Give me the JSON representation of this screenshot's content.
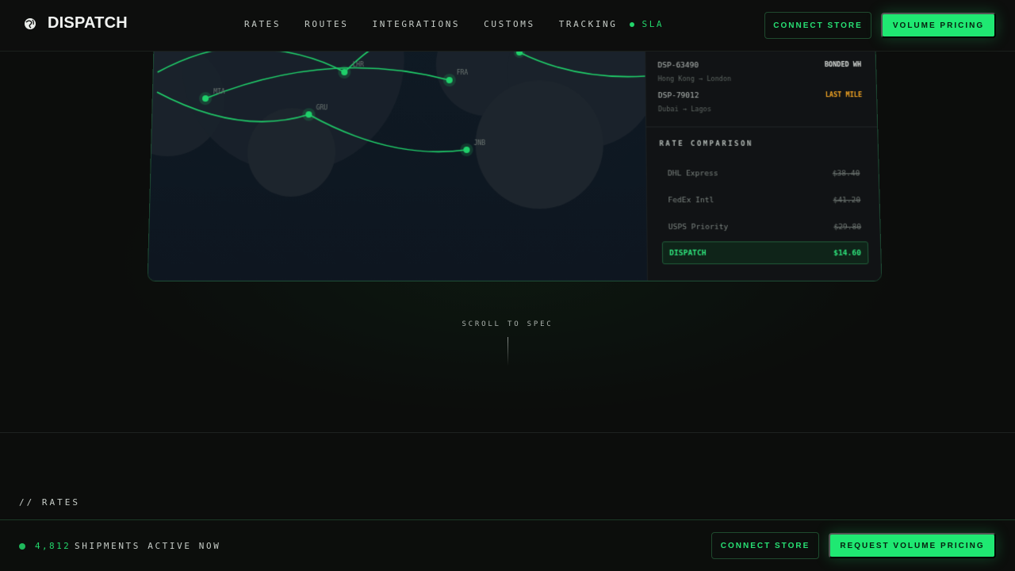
{
  "brand": {
    "name": "DISPATCH",
    "logo_icon": "globe-icon"
  },
  "nav": {
    "links": [
      "RATES",
      "ROUTES",
      "INTEGRATIONS",
      "CUSTOMS",
      "TRACKING"
    ],
    "sla_label": "SLA",
    "connect_store": "CONNECT STORE",
    "volume_pricing": "VOLUME PRICING"
  },
  "map": {
    "cities": [
      "MIA",
      "LHR",
      "FRA",
      "GRU",
      "JNB"
    ]
  },
  "shipments": [
    {
      "id": "DSP-63490",
      "route": "Hong Kong → London",
      "status": "BONDED WH",
      "status_color": "#d8dcd9"
    },
    {
      "id": "DSP-79012",
      "route": "Dubai → Lagos",
      "status": "LAST MILE",
      "status_color": "#f0a323"
    }
  ],
  "rate_comparison": {
    "title": "RATE COMPARISON",
    "rows": [
      {
        "carrier": "DHL Express",
        "price": "$38.40",
        "best": false
      },
      {
        "carrier": "FedEx Intl",
        "price": "$41.20",
        "best": false
      },
      {
        "carrier": "USPS Priority",
        "price": "$29.80",
        "best": false
      },
      {
        "carrier": "DISPATCH",
        "price": "$14.60",
        "best": true
      }
    ]
  },
  "scroll": {
    "label": "SCROLL TO SPEC"
  },
  "section": {
    "label": "// RATES"
  },
  "bottom_bar": {
    "active_count": "4,812",
    "active_text": "SHIPMENTS ACTIVE NOW",
    "connect_store": "CONNECT STORE",
    "request_pricing": "REQUEST VOLUME PRICING"
  },
  "colors": {
    "accent": "#1fe872",
    "warning": "#f0a323",
    "background": "#0c0d0c"
  }
}
